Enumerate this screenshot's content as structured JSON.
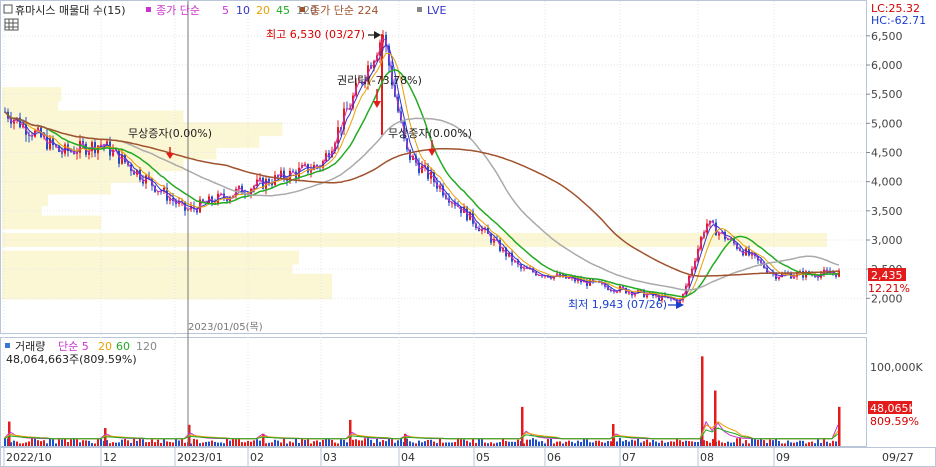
{
  "price_panel": {
    "checkbox_label": "휴마시스 매물대 수(15)",
    "legend": [
      {
        "text": "종가 단순",
        "color": "#cc33cc"
      },
      {
        "text": "5",
        "color": "#cc33cc"
      },
      {
        "text": "10",
        "color": "#3333cc"
      },
      {
        "text": "20",
        "color": "#e8a000"
      },
      {
        "text": "45",
        "color": "#22aa22"
      },
      {
        "text": "120",
        "color": "#888888"
      },
      {
        "text": "종가 단순 224",
        "color": "#a0522d"
      },
      {
        "text": "LVE",
        "color": "#3333cc"
      }
    ],
    "lc_label": "LC:25.32",
    "hc_label": "HC:-62.71",
    "y_ticks": [
      "6,500",
      "6,000",
      "5,500",
      "5,000",
      "4,500",
      "4,000",
      "3,500",
      "3,000",
      "2,500",
      "2,000"
    ],
    "current_price": "2,435",
    "current_change": "12.21%",
    "high_annotation": "최고 6,530 (03/27)",
    "low_annotation": "최저 1,943 (07/26)",
    "event_1": "권리락(-73.78%)",
    "event_2": "무상증자(0.00%)",
    "event_3": "무상증자(0.00%)",
    "crosshair_date": "2023/01/05(목)"
  },
  "volume_panel": {
    "legend_title": "거래량",
    "legend": [
      {
        "text": "단순 5",
        "color": "#cc33cc"
      },
      {
        "text": "20",
        "color": "#e8a000"
      },
      {
        "text": "60",
        "color": "#22aa22"
      },
      {
        "text": "120",
        "color": "#888888"
      }
    ],
    "readout": "48,064,663주(809.59%)",
    "y_tick": "100,000K",
    "current_volume": "48,065K",
    "current_pct": "809.59%"
  },
  "x_axis": {
    "ticks": [
      "2022/10",
      "12",
      "2023/01",
      "02",
      "03",
      "04",
      "05",
      "06",
      "07",
      "08",
      "09",
      "09/27"
    ]
  },
  "chart_data": {
    "type": "candlestick",
    "ylim": [
      1800,
      6600
    ],
    "volume_ylim": [
      0,
      130000
    ],
    "price_path": [
      [
        "2022/10",
        5200
      ],
      [
        "2022/11",
        4500
      ],
      [
        "2022/12",
        4650
      ],
      [
        "2023/01",
        3500
      ],
      [
        "2023/02",
        3900
      ],
      [
        "2023/03",
        4300
      ],
      [
        "2023/03/27",
        6530
      ],
      [
        "2023/04",
        4500
      ],
      [
        "2023/05",
        3300
      ],
      [
        "2023/06",
        2500
      ],
      [
        "2023/07/26",
        1943
      ],
      [
        "2023/08",
        3300
      ],
      [
        "2023/09",
        2400
      ],
      [
        "2023/09/27",
        2435
      ]
    ],
    "volume_spikes_k": [
      [
        "2022/10",
        30000
      ],
      [
        "2022/11",
        22000
      ],
      [
        "2023/01",
        26000
      ],
      [
        "2023/02",
        15000
      ],
      [
        "2023/03",
        32000
      ],
      [
        "2023/04",
        15000
      ],
      [
        "2023/05",
        48000
      ],
      [
        "2023/07",
        27000
      ],
      [
        "2023/08",
        110000
      ],
      [
        "2023/08",
        68000
      ],
      [
        "2023/09/27",
        48065
      ]
    ],
    "volume_profile": [
      {
        "price": 5500,
        "rel": 0.18
      },
      {
        "price": 5300,
        "rel": 0.17
      },
      {
        "price": 5100,
        "rel": 0.55
      },
      {
        "price": 4900,
        "rel": 0.85
      },
      {
        "price": 4700,
        "rel": 0.78
      },
      {
        "price": 4500,
        "rel": 0.65
      },
      {
        "price": 4300,
        "rel": 0.55
      },
      {
        "price": 4100,
        "rel": 0.46
      },
      {
        "price": 3900,
        "rel": 0.33
      },
      {
        "price": 3700,
        "rel": 0.14
      },
      {
        "price": 3500,
        "rel": 0.12
      },
      {
        "price": 3300,
        "rel": 0.3
      },
      {
        "price": 3000,
        "rel": 2.5
      },
      {
        "price": 2700,
        "rel": 0.9
      },
      {
        "price": 2500,
        "rel": 0.88
      },
      {
        "price": 2300,
        "rel": 1.0
      },
      {
        "price": 2100,
        "rel": 1.0
      }
    ]
  }
}
